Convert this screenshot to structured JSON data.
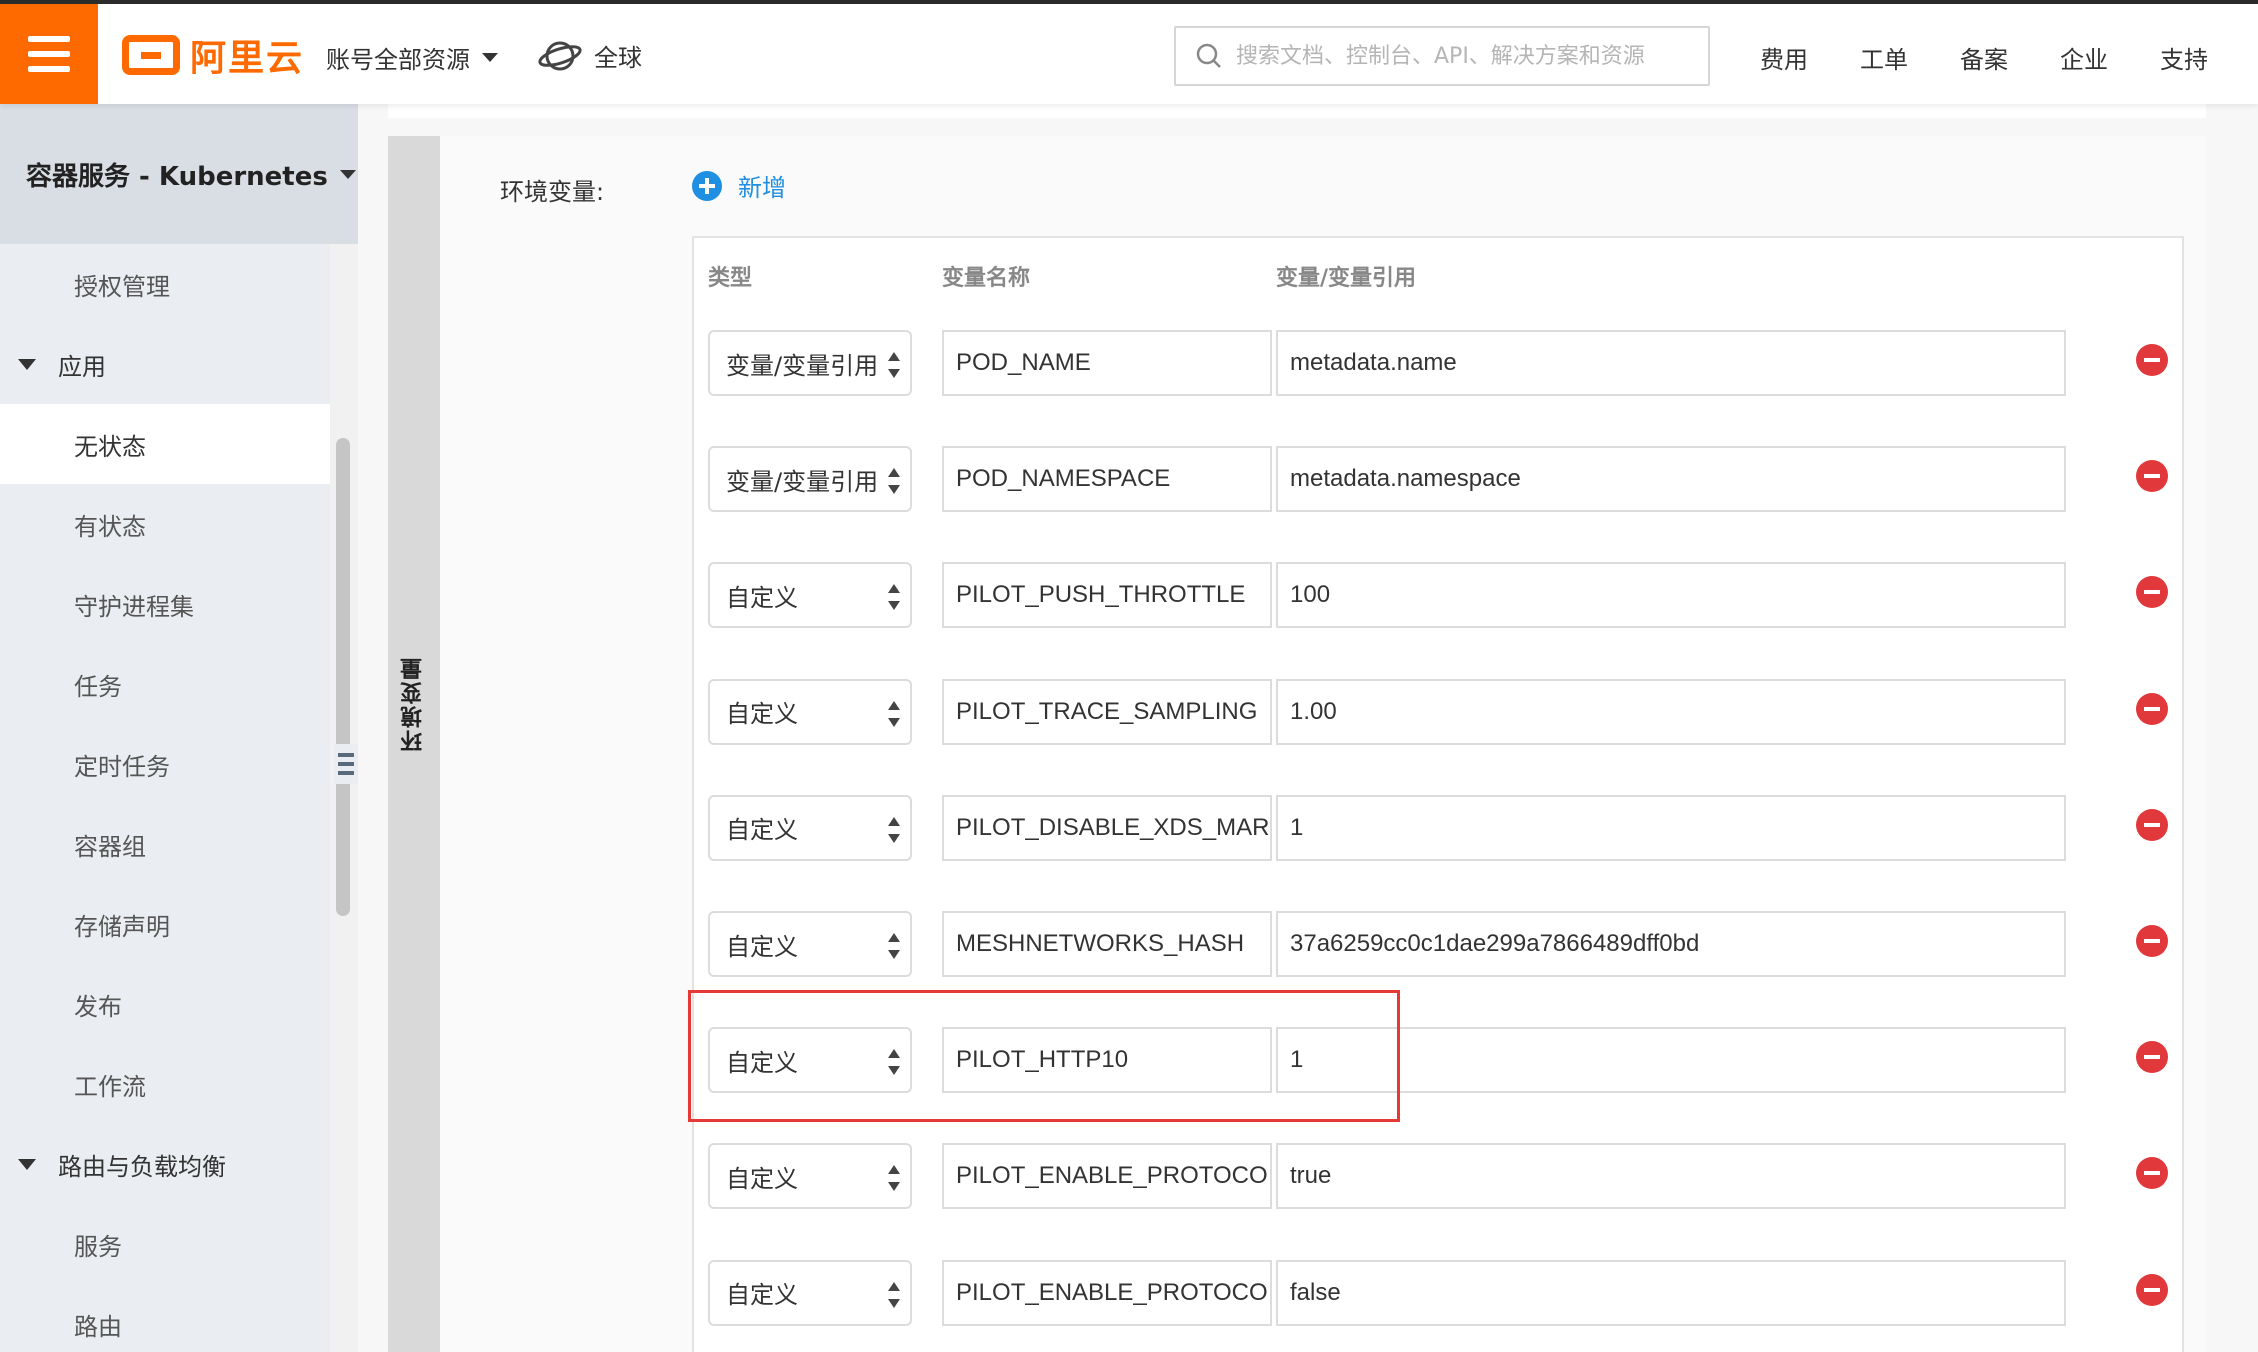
{
  "topbar": {
    "logo_text": "阿里云",
    "resources_label": "账号全部资源",
    "region_label": "全球",
    "search_placeholder": "搜索文档、控制台、API、解决方案和资源",
    "links": [
      "费用",
      "工单",
      "备案",
      "企业",
      "支持"
    ]
  },
  "sidebar": {
    "title": "容器服务 - Kubernetes",
    "items": [
      {
        "type": "item",
        "label": "授权管理"
      },
      {
        "type": "group",
        "label": "应用"
      },
      {
        "type": "item",
        "label": "无状态",
        "active": true
      },
      {
        "type": "item",
        "label": "有状态"
      },
      {
        "type": "item",
        "label": "守护进程集"
      },
      {
        "type": "item",
        "label": "任务"
      },
      {
        "type": "item",
        "label": "定时任务"
      },
      {
        "type": "item",
        "label": "容器组"
      },
      {
        "type": "item",
        "label": "存储声明"
      },
      {
        "type": "item",
        "label": "发布"
      },
      {
        "type": "item",
        "label": "工作流"
      },
      {
        "type": "group",
        "label": "路由与负载均衡"
      },
      {
        "type": "item",
        "label": "服务"
      },
      {
        "type": "item",
        "label": "路由"
      }
    ]
  },
  "panel": {
    "tab_label": "环境变量",
    "env_label": "环境变量:",
    "add_label": "新增",
    "columns": [
      "类型",
      "变量名称",
      "变量/变量引用"
    ],
    "rows": [
      {
        "type": "变量/变量引用",
        "name": "POD_NAME",
        "value": "metadata.name"
      },
      {
        "type": "变量/变量引用",
        "name": "POD_NAMESPACE",
        "value": "metadata.namespace"
      },
      {
        "type": "自定义",
        "name": "PILOT_PUSH_THROTTLE",
        "value": "100"
      },
      {
        "type": "自定义",
        "name": "PILOT_TRACE_SAMPLING",
        "value": "1.00"
      },
      {
        "type": "自定义",
        "name": "PILOT_DISABLE_XDS_MAR",
        "value": "1"
      },
      {
        "type": "自定义",
        "name": "MESHNETWORKS_HASH",
        "value": "37a6259cc0c1dae299a7866489dff0bd"
      },
      {
        "type": "自定义",
        "name": "PILOT_HTTP10",
        "value": "1"
      },
      {
        "type": "自定义",
        "name": "PILOT_ENABLE_PROTOCO",
        "value": "true"
      },
      {
        "type": "自定义",
        "name": "PILOT_ENABLE_PROTOCO",
        "value": "false"
      }
    ]
  },
  "colors": {
    "brand": "#ff6a00",
    "link": "#1e8fe1",
    "delete": "#e0383b",
    "highlight": "#e53935"
  }
}
